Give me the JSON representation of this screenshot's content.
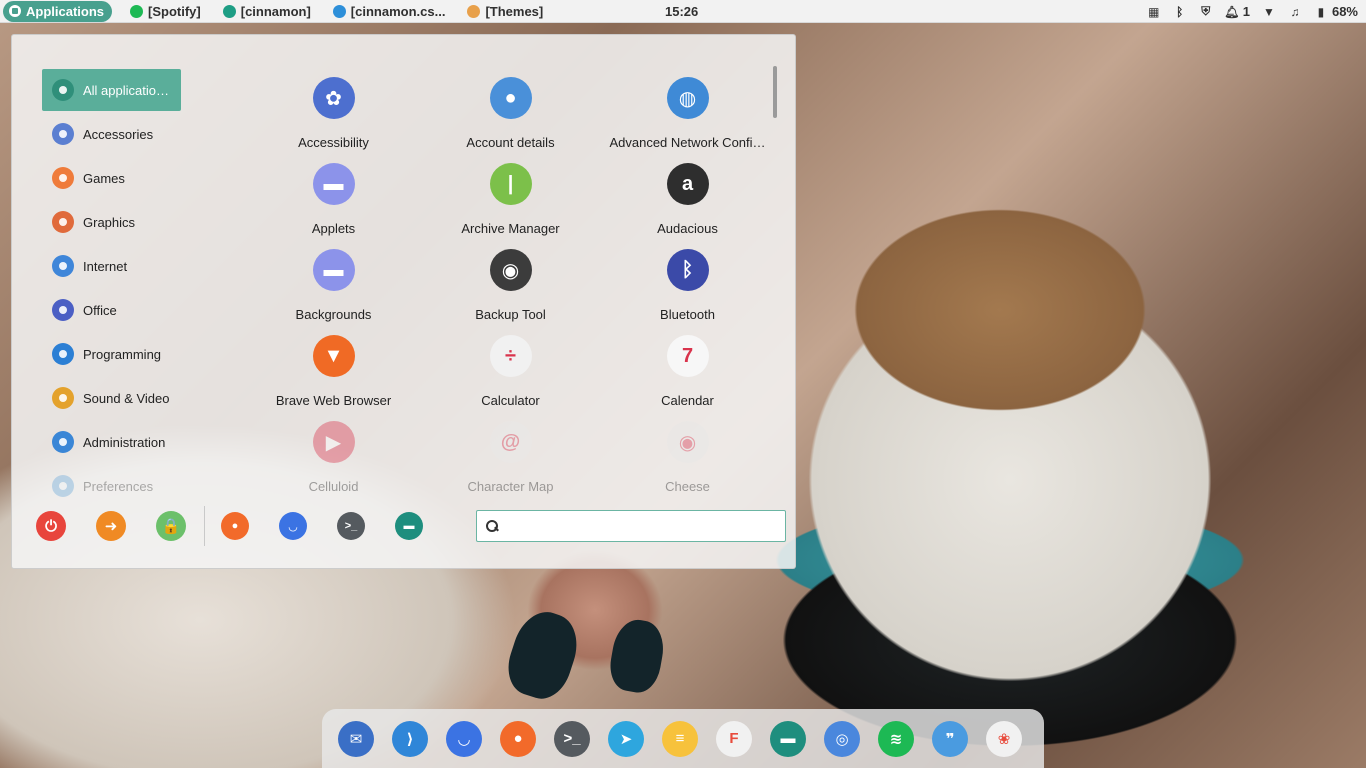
{
  "panel": {
    "menu_label": "Applications",
    "tasks": [
      {
        "label": "[Spotify]",
        "icon": "spotify-icon",
        "color": "#1db954"
      },
      {
        "label": "[cinnamon]",
        "icon": "terminal-icon",
        "color": "#1e9e85"
      },
      {
        "label": "[cinnamon.cs...",
        "icon": "vscode-icon",
        "color": "#2d8fd9"
      },
      {
        "label": "[Themes]",
        "icon": "themes-icon",
        "color": "#e8a04a"
      }
    ],
    "clock": "15:26",
    "notifications_count": "1",
    "battery": "68%"
  },
  "menu": {
    "categories": [
      {
        "label": "All applicatio…",
        "icon": "all-apps-icon",
        "color": "#2f8f7a"
      },
      {
        "label": "Accessories",
        "icon": "accessories-icon",
        "color": "#5b7fd1"
      },
      {
        "label": "Games",
        "icon": "games-icon",
        "color": "#ef7b3a"
      },
      {
        "label": "Graphics",
        "icon": "graphics-icon",
        "color": "#e06a3b"
      },
      {
        "label": "Internet",
        "icon": "internet-icon",
        "color": "#3f86d9"
      },
      {
        "label": "Office",
        "icon": "office-icon",
        "color": "#4b5fc4"
      },
      {
        "label": "Programming",
        "icon": "programming-icon",
        "color": "#2c7fd4"
      },
      {
        "label": "Sound & Video",
        "icon": "sound-video-icon",
        "color": "#e4a22c"
      },
      {
        "label": "Administration",
        "icon": "administration-icon",
        "color": "#3a86d6"
      },
      {
        "label": "Preferences",
        "icon": "preferences-icon",
        "color": "#5aa0d8"
      }
    ],
    "apps": [
      {
        "label": "Accessibility",
        "icon": "accessibility-icon",
        "color": "#4d6fcf",
        "glyph": "✿"
      },
      {
        "label": "Account details",
        "icon": "account-icon",
        "color": "#4a90d9",
        "glyph": "●"
      },
      {
        "label": "Advanced Network Confi…",
        "icon": "network-icon",
        "color": "#3f8ad6",
        "glyph": "◍"
      },
      {
        "label": "Applets",
        "icon": "applets-icon",
        "color": "#8c93ea",
        "glyph": "▬"
      },
      {
        "label": "Archive Manager",
        "icon": "archive-icon",
        "color": "#7cc04a",
        "glyph": "|"
      },
      {
        "label": "Audacious",
        "icon": "audacious-icon",
        "color": "#2e2e2e",
        "glyph": "a"
      },
      {
        "label": "Backgrounds",
        "icon": "backgrounds-icon",
        "color": "#8c93ea",
        "glyph": "▬"
      },
      {
        "label": "Backup Tool",
        "icon": "backup-icon",
        "color": "#3c3c3c",
        "glyph": "◉"
      },
      {
        "label": "Bluetooth",
        "icon": "bluetooth-icon",
        "color": "#3b4aa8",
        "glyph": "ᛒ"
      },
      {
        "label": "Brave Web Browser",
        "icon": "brave-icon",
        "color": "#f06a25",
        "glyph": "▼"
      },
      {
        "label": "Calculator",
        "icon": "calculator-icon",
        "color": "#f1f1f1",
        "glyph": "÷"
      },
      {
        "label": "Calendar",
        "icon": "calendar-icon",
        "color": "#f7f7f7",
        "glyph": "7"
      },
      {
        "label": "Celluloid",
        "icon": "celluloid-icon",
        "color": "#d9334c",
        "glyph": "▶"
      },
      {
        "label": "Character Map",
        "icon": "charmap-icon",
        "color": "#e9e9e9",
        "glyph": "@"
      },
      {
        "label": "Cheese",
        "icon": "cheese-icon",
        "color": "#e7e7e7",
        "glyph": "◉"
      }
    ],
    "session_buttons": [
      {
        "name": "shutdown-button",
        "icon": "power-icon",
        "color": "#e8453c",
        "glyph": "⏻"
      },
      {
        "name": "logout-button",
        "icon": "logout-icon",
        "color": "#f08a24",
        "glyph": "➜"
      },
      {
        "name": "lock-button",
        "icon": "lock-icon",
        "color": "#6cc06a",
        "glyph": "🔒"
      }
    ],
    "favorites": [
      {
        "name": "fav-firefox",
        "icon": "firefox-icon",
        "color": "#f26a2a",
        "glyph": "●"
      },
      {
        "name": "fav-software",
        "icon": "software-manager-icon",
        "color": "#3b73e3",
        "glyph": "◡"
      },
      {
        "name": "fav-terminal",
        "icon": "terminal-icon",
        "color": "#555a5f",
        "glyph": ">_"
      },
      {
        "name": "fav-files",
        "icon": "folder-icon",
        "color": "#1e8e7e",
        "glyph": "▬"
      }
    ],
    "search": {
      "value": "",
      "placeholder": ""
    }
  },
  "dock": [
    {
      "name": "dock-thunderbird",
      "icon": "thunderbird-icon",
      "color": "#3a6fc6",
      "glyph": "✉"
    },
    {
      "name": "dock-vscode",
      "icon": "vscode-icon",
      "color": "#2f86d8",
      "glyph": "⟩"
    },
    {
      "name": "dock-software",
      "icon": "software-manager-icon",
      "color": "#3b73e3",
      "glyph": "◡"
    },
    {
      "name": "dock-firefox",
      "icon": "firefox-icon",
      "color": "#f26a2a",
      "glyph": "●"
    },
    {
      "name": "dock-terminal",
      "icon": "terminal-icon",
      "color": "#555a5f",
      "glyph": ">_"
    },
    {
      "name": "dock-telegram",
      "icon": "telegram-icon",
      "color": "#2ea6de",
      "glyph": "➤"
    },
    {
      "name": "dock-notes",
      "icon": "notes-icon",
      "color": "#f7c23c",
      "glyph": "≡"
    },
    {
      "name": "dock-flathub",
      "icon": "flathub-icon",
      "color": "#f1f1f1",
      "glyph": "F"
    },
    {
      "name": "dock-files",
      "icon": "folder-icon",
      "color": "#1e8e7e",
      "glyph": "▬"
    },
    {
      "name": "dock-chromium",
      "icon": "chromium-icon",
      "color": "#4a87dd",
      "glyph": "◎"
    },
    {
      "name": "dock-spotify",
      "icon": "spotify-icon",
      "color": "#1db954",
      "glyph": "≋"
    },
    {
      "name": "dock-quotes",
      "icon": "quotes-icon",
      "color": "#4a9be0",
      "glyph": "❞"
    },
    {
      "name": "dock-photos",
      "icon": "photos-icon",
      "color": "#f1f1f1",
      "glyph": "❀"
    }
  ]
}
